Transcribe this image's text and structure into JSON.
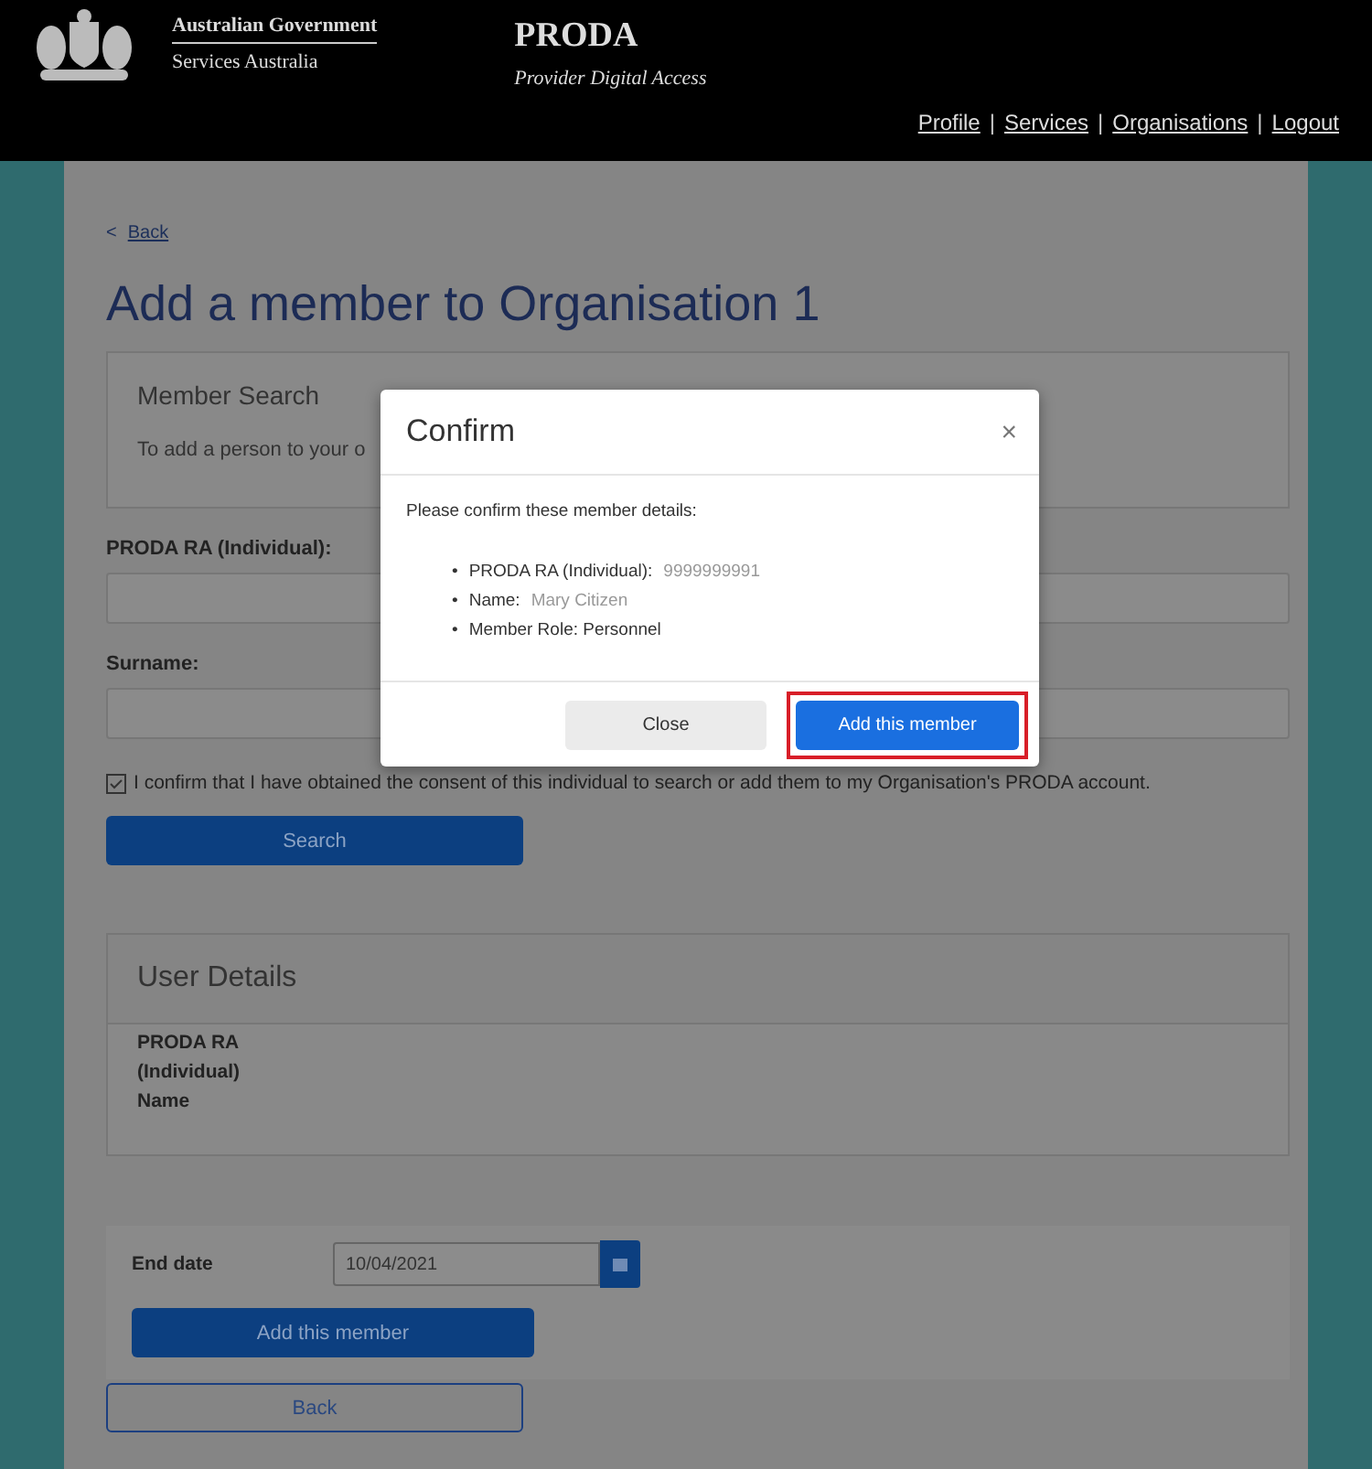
{
  "header": {
    "gov_line1": "Australian Government",
    "gov_line2": "Services Australia",
    "app_title": "PRODA",
    "app_subtitle": "Provider Digital Access",
    "nav": [
      "Profile",
      "Services",
      "Organisations",
      "Logout"
    ],
    "nav_separator": "|"
  },
  "back_link": {
    "icon": "<",
    "label": "Back"
  },
  "page_title": "Add a member to Organisation 1",
  "member_search": {
    "title": "Member Search",
    "text": "To add a person to your o"
  },
  "fields": [
    {
      "label": "PRODA RA (Individual):"
    },
    {
      "label": "Surname:"
    }
  ],
  "consent": {
    "checked": true,
    "text": "I confirm that I have obtained the consent of this individual to search or add them to my Organisation's PRODA account."
  },
  "search_button": "Search",
  "user_details": {
    "title": "User Details",
    "labels": [
      "PRODA RA",
      "(Individual)",
      "Name"
    ]
  },
  "end_date": {
    "label": "End date",
    "value": "10/04/2021"
  },
  "add_button": "Add this member",
  "back_button": "Back",
  "dialog": {
    "title": "Confirm",
    "close_icon": "×",
    "intro": "Please confirm these member details:",
    "details": [
      {
        "marker": "•",
        "label": "PRODA RA (Individual):",
        "value": "9999999991"
      },
      {
        "marker": "•",
        "label": "Name:",
        "value": "Mary Citizen"
      },
      {
        "marker": "•",
        "label": "Member Role: Personnel"
      }
    ],
    "buttons": [
      {
        "label": "Close",
        "kind": "secondary",
        "highlighted": false
      },
      {
        "label": "Add this member",
        "kind": "primary",
        "highlighted": true
      }
    ]
  }
}
